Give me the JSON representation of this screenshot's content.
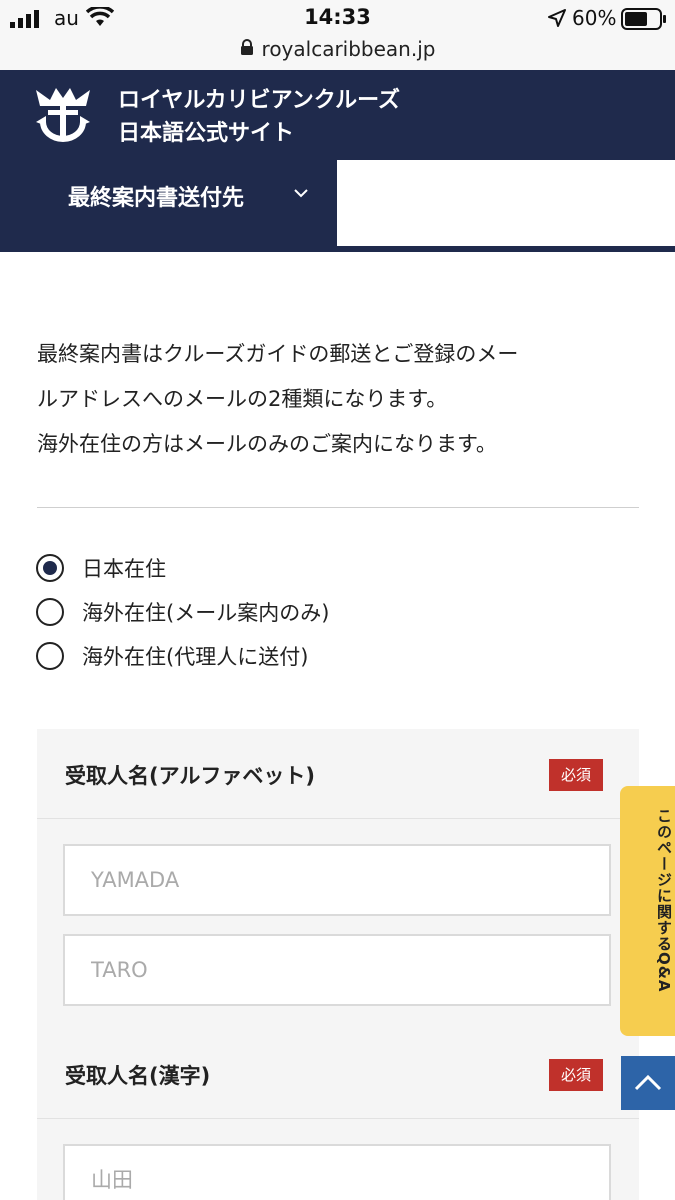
{
  "status_bar": {
    "carrier": "au",
    "time": "14:33",
    "battery": "60%"
  },
  "browser": {
    "url": "royalcaribbean.jp"
  },
  "header": {
    "brand_line1": "ロイヤルカリビアンクルーズ",
    "brand_line2": "日本語公式サイト",
    "nav_dropdown": "最終案内書送付先"
  },
  "intro": {
    "line1": "最終案内書はクルーズガイドの郵送とご登録のメー",
    "line2": "ルアドレスへのメールの2種類になります。",
    "line3": "海外在住の方はメールのみのご案内になります。"
  },
  "residence_options": [
    {
      "label": "日本在住",
      "checked": true
    },
    {
      "label": "海外在住(メール案内のみ)",
      "checked": false
    },
    {
      "label": "海外在住(代理人に送付)",
      "checked": false
    }
  ],
  "form": {
    "recipient_alpha": {
      "title": "受取人名(アルファベット)",
      "required": "必須",
      "last_placeholder": "YAMADA",
      "first_placeholder": "TARO"
    },
    "recipient_kanji": {
      "title": "受取人名(漢字)",
      "required": "必須",
      "last_placeholder": "山田"
    }
  },
  "floating": {
    "qa_tab": "このページに関するQ&A",
    "to_top_icon": "chevron-up-icon"
  },
  "colors": {
    "navy": "#1f2a4c",
    "required_red": "#c0312b",
    "qa_yellow": "#f6cd4f",
    "to_top_blue": "#2d64a8"
  }
}
